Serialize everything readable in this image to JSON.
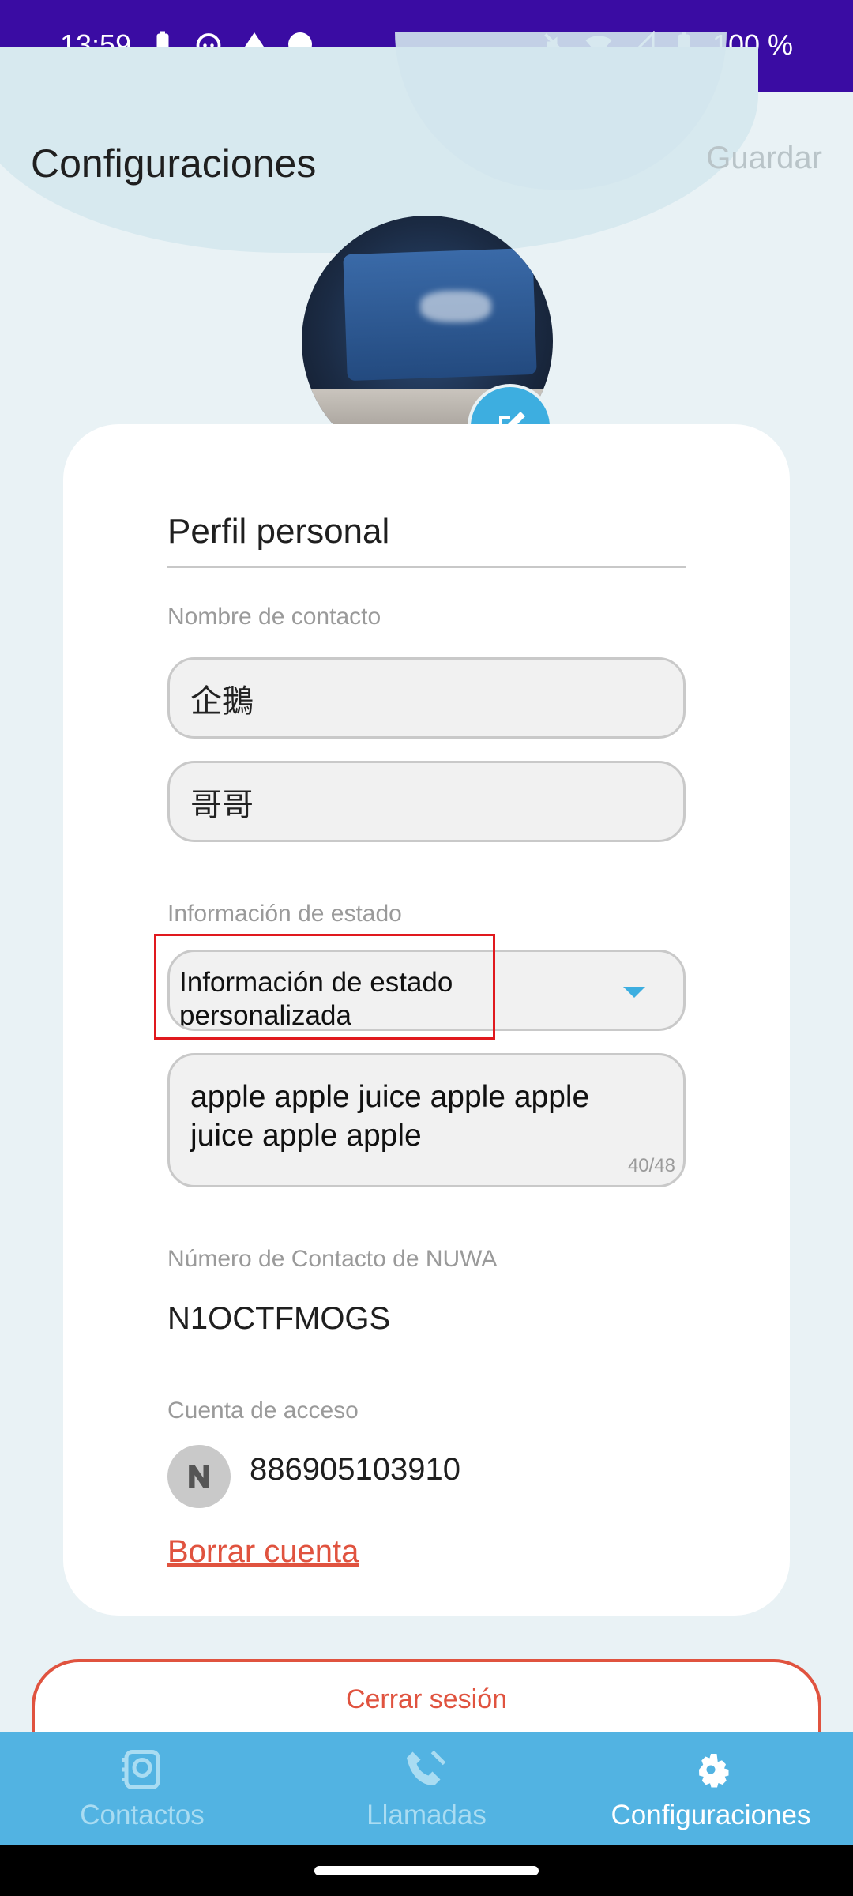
{
  "status_bar": {
    "time": "13:59",
    "battery": "100 %",
    "icons_left": [
      "battery-icon",
      "cat-icon",
      "mm-alert-icon",
      "circle-icon"
    ],
    "icons_right": [
      "mute-icon",
      "wifi-icon",
      "signal-icon",
      "battery-icon"
    ]
  },
  "header": {
    "title": "Configuraciones",
    "save_label": "Guardar"
  },
  "profile": {
    "section_title": "Perfil personal",
    "contact_name_label": "Nombre de contacto",
    "first_name": "企鵝",
    "last_name": "哥哥",
    "status_label": "Información de estado",
    "status_select_value": "Información de estado personalizada",
    "status_text": "apple apple juice apple apple juice apple apple",
    "status_counter": "40/48",
    "nuwa_label": "Número de Contacto de NUWA",
    "nuwa_value": "N1OCTFMOGS",
    "account_label": "Cuenta de acceso",
    "account_value": "886905103910",
    "delete_label": "Borrar cuenta"
  },
  "logout_label": "Cerrar sesión",
  "bottom_nav": {
    "items": [
      {
        "label": "Contactos",
        "icon": "contacts-icon",
        "active": false
      },
      {
        "label": "Llamadas",
        "icon": "calls-icon",
        "active": false
      },
      {
        "label": "Configuraciones",
        "icon": "gear-icon",
        "active": true
      }
    ]
  },
  "colors": {
    "status_bar": "#3a0ca3",
    "accent": "#3daee0",
    "nav_bg": "#52b3e2",
    "danger": "#e0533f",
    "highlight": "#e0191e"
  }
}
